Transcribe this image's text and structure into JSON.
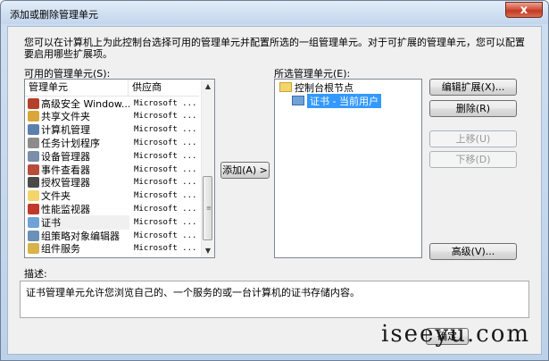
{
  "window": {
    "title": "添加或删除管理单元",
    "close_glyph": "x"
  },
  "intro": "您可以在计算机上为此控制台选择可用的管理单元并配置所选的一组管理单元。对于可扩展的管理单元，您可以配置要启用哪些扩展项。",
  "available": {
    "label": "可用的管理单元(S):",
    "columns": [
      "管理单元",
      "供应商"
    ],
    "items": [
      {
        "name": "高级安全 Window...",
        "vendor": "Microsoft ...",
        "icon": "firewall-icon",
        "color": "#b5412b"
      },
      {
        "name": "共享文件夹",
        "vendor": "Microsoft ...",
        "icon": "shared-folder-icon",
        "color": "#d9a63a"
      },
      {
        "name": "计算机管理",
        "vendor": "Microsoft ...",
        "icon": "computer-management-icon",
        "color": "#5c7fae"
      },
      {
        "name": "任务计划程序",
        "vendor": "Microsoft ...",
        "icon": "clock-icon",
        "color": "#8c8c8c"
      },
      {
        "name": "设备管理器",
        "vendor": "Microsoft ...",
        "icon": "device-manager-icon",
        "color": "#7a8fa8"
      },
      {
        "name": "事件查看器",
        "vendor": "Microsoft ...",
        "icon": "event-viewer-icon",
        "color": "#b84c3a"
      },
      {
        "name": "授权管理器",
        "vendor": "Microsoft ...",
        "icon": "authorization-icon",
        "color": "#4a4a4a"
      },
      {
        "name": "文件夹",
        "vendor": "Microsoft ...",
        "icon": "folder-icon",
        "color": "#f3d56b"
      },
      {
        "name": "性能监视器",
        "vendor": "Microsoft ...",
        "icon": "performance-icon",
        "color": "#c0392b"
      },
      {
        "name": "证书",
        "vendor": "Microsoft ...",
        "icon": "certificate-icon",
        "color": "#6fa3d8"
      },
      {
        "name": "组策略对象编辑器",
        "vendor": "Microsoft ...",
        "icon": "group-policy-icon",
        "color": "#6b8fb8"
      },
      {
        "name": "组件服务",
        "vendor": "Microsoft ...",
        "icon": "component-services-icon",
        "color": "#d8b24a"
      }
    ],
    "selected_index": 9
  },
  "buttons": {
    "add": "添加(A) >",
    "edit_extensions": "编辑扩展(X)...",
    "remove": "删除(R)",
    "move_up": "上移(U)",
    "move_down": "下移(D)",
    "advanced": "高级(V)...",
    "ok": "确定"
  },
  "selected": {
    "label": "所选管理单元(E):",
    "root": "控制台根节点",
    "child": "证书 - 当前用户"
  },
  "description": {
    "label": "描述:",
    "text": "证书管理单元允许您浏览自己的、一个服务的或一台计算机的证书存储内容。"
  },
  "watermark": "iseeyu.com",
  "colors": {
    "selection": "#3399ff",
    "close_button": "#c9452c"
  }
}
